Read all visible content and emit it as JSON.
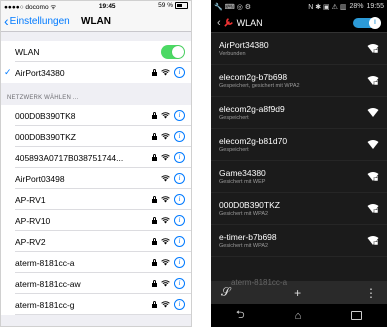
{
  "ios": {
    "status": {
      "carrier": "●●●●○ docomo ᯤ",
      "time": "19:45",
      "battery": "59 %"
    },
    "nav": {
      "back_label": "Einstellungen",
      "title": "WLAN"
    },
    "wlan_row": {
      "label": "WLAN",
      "enabled": true
    },
    "connected": {
      "name": "AirPort34380"
    },
    "section_header": "NETZWERK WÄHLEN ...",
    "networks": [
      {
        "name": "000D0B390TK8",
        "locked": true
      },
      {
        "name": "000D0B390TKZ",
        "locked": true
      },
      {
        "name": "405893A0717B038751744...",
        "locked": true
      },
      {
        "name": "AirPort03498",
        "locked": false
      },
      {
        "name": "AP-RV1",
        "locked": true
      },
      {
        "name": "AP-RV10",
        "locked": true
      },
      {
        "name": "AP-RV2",
        "locked": true
      },
      {
        "name": "aterm-8181cc-a",
        "locked": true
      },
      {
        "name": "aterm-8181cc-aw",
        "locked": true
      },
      {
        "name": "aterm-8181cc-g",
        "locked": true
      }
    ],
    "accent": "#007aff",
    "toggle_color": "#4cd964"
  },
  "android": {
    "status": {
      "left_icons": "🔧 ⌨ ◎ ⚙",
      "right_icons": "N ✱ ▣ ⚠ ▥",
      "battery": "28%",
      "time": "19:55"
    },
    "action_bar": {
      "title": "WLAN",
      "toggle_label": "I"
    },
    "networks": [
      {
        "name": "AirPort34380",
        "status": "Verbunden",
        "locked": true
      },
      {
        "name": "elecom2g-b7b698",
        "status": "Gespeichert, gesichert mit WPA2",
        "locked": true
      },
      {
        "name": "elecom2g-a8f9d9",
        "status": "Gespeichert",
        "locked": false
      },
      {
        "name": "elecom2g-b81d70",
        "status": "Gespeichert",
        "locked": false
      },
      {
        "name": "Game34380",
        "status": "Gesichert mit WEP",
        "locked": true
      },
      {
        "name": "000D0B390TKZ",
        "status": "Gesichert mit WPA2",
        "locked": true
      },
      {
        "name": "e-timer-b7b698",
        "status": "Gesichert mit WPA2",
        "locked": true
      }
    ],
    "bottom_peek": "aterm-8181cc-a",
    "bottom_bar": {
      "wps": "𝒮",
      "add": "+",
      "menu": "⋮"
    },
    "nav": {
      "back": "⮌",
      "home": "⌂"
    },
    "accent": "#2c9ad7"
  }
}
